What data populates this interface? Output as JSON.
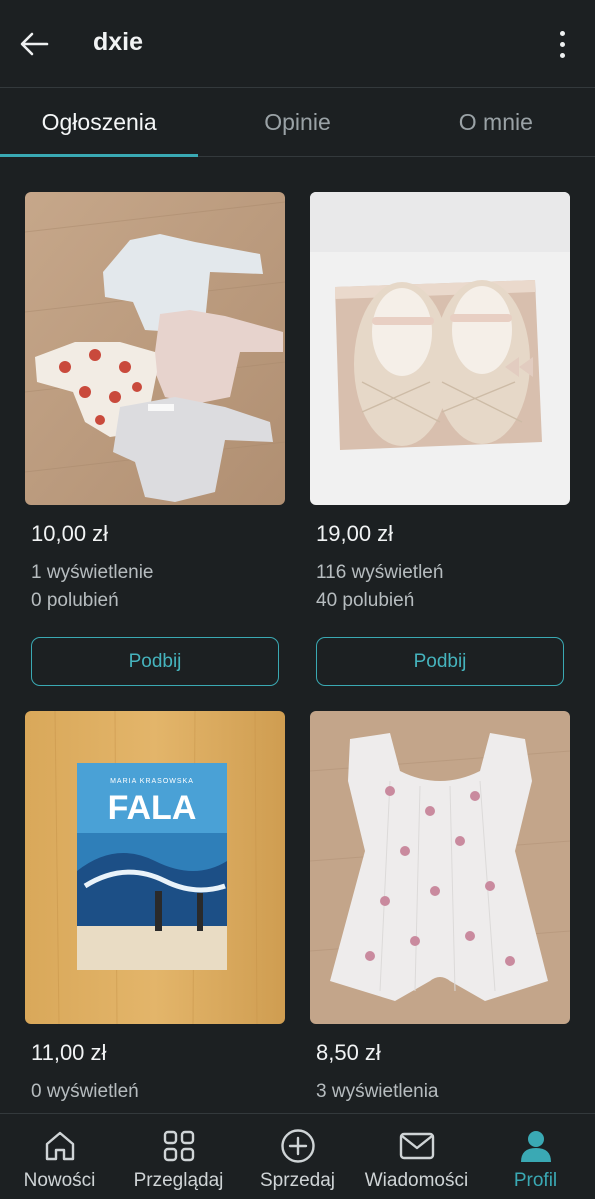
{
  "header": {
    "title": "dxie"
  },
  "tabs": [
    {
      "label": "Ogłoszenia",
      "active": true
    },
    {
      "label": "Opinie",
      "active": false
    },
    {
      "label": "O mnie",
      "active": false
    }
  ],
  "items": [
    {
      "price": "10,00 zł",
      "views": "1 wyświetlenie",
      "likes": "0 polubień",
      "button": "Podbij",
      "image": "baby-bodysuits-photo"
    },
    {
      "price": "19,00 zł",
      "views": "116 wyświetleń",
      "likes": "40 polubień",
      "button": "Podbij",
      "image": "baby-shoes-photo"
    },
    {
      "price": "11,00 zł",
      "views": "0 wyświetleń",
      "image": "book-fala-photo",
      "book_author": "MARIA KRASOWSKA",
      "book_title": "FALA"
    },
    {
      "price": "8,50 zł",
      "views": "3 wyświetlenia",
      "image": "floral-romper-photo"
    }
  ],
  "nav": [
    {
      "label": "Nowości",
      "icon": "home-icon",
      "active": false
    },
    {
      "label": "Przeglądaj",
      "icon": "grid-icon",
      "active": false
    },
    {
      "label": "Sprzedaj",
      "icon": "plus-circle-icon",
      "active": false
    },
    {
      "label": "Wiadomości",
      "icon": "mail-icon",
      "active": false
    },
    {
      "label": "Profil",
      "icon": "person-icon",
      "active": true
    }
  ],
  "colors": {
    "background": "#1c2022",
    "accent": "#3aa9b4"
  }
}
